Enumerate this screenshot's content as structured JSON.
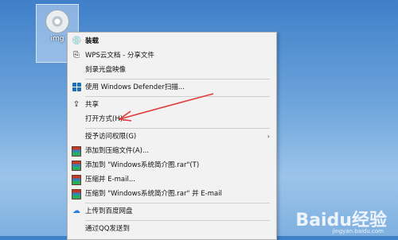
{
  "desktop_icon": {
    "label": "img"
  },
  "menu": {
    "items": [
      {
        "label": "装载",
        "icon": "disc-icon",
        "bold": true
      },
      {
        "label": "WPS云文档 - 分享文件",
        "icon": "wps-cloud-icon"
      },
      {
        "label": "刻录光盘映像",
        "icon": ""
      },
      {
        "label": "使用 Windows Defender扫描...",
        "icon": "windows-defender-icon"
      },
      {
        "label": "共享",
        "icon": "share-icon"
      },
      {
        "label": "打开方式(H)...",
        "icon": ""
      },
      {
        "label": "授予访问权限(G)",
        "icon": "",
        "submenu": true
      },
      {
        "label": "添加到压缩文件(A)...",
        "icon": "winrar-icon"
      },
      {
        "label": "添加到 \"Windows系统简介图.rar\"(T)",
        "icon": "winrar-icon"
      },
      {
        "label": "压缩并 E-mail...",
        "icon": "winrar-icon"
      },
      {
        "label": "压缩到 \"Windows系统简介图.rar\" 并 E-mail",
        "icon": "winrar-icon"
      },
      {
        "label": "上传到百度网盘",
        "icon": "baidu-netdisk-icon"
      },
      {
        "label": "通过QQ发送到",
        "icon": ""
      }
    ],
    "submenu_arrow": "›"
  },
  "watermark": {
    "text": "Baidu经验",
    "sub": "jingyan.baidu.com"
  },
  "annotation": {
    "color": "#e03a3a"
  }
}
